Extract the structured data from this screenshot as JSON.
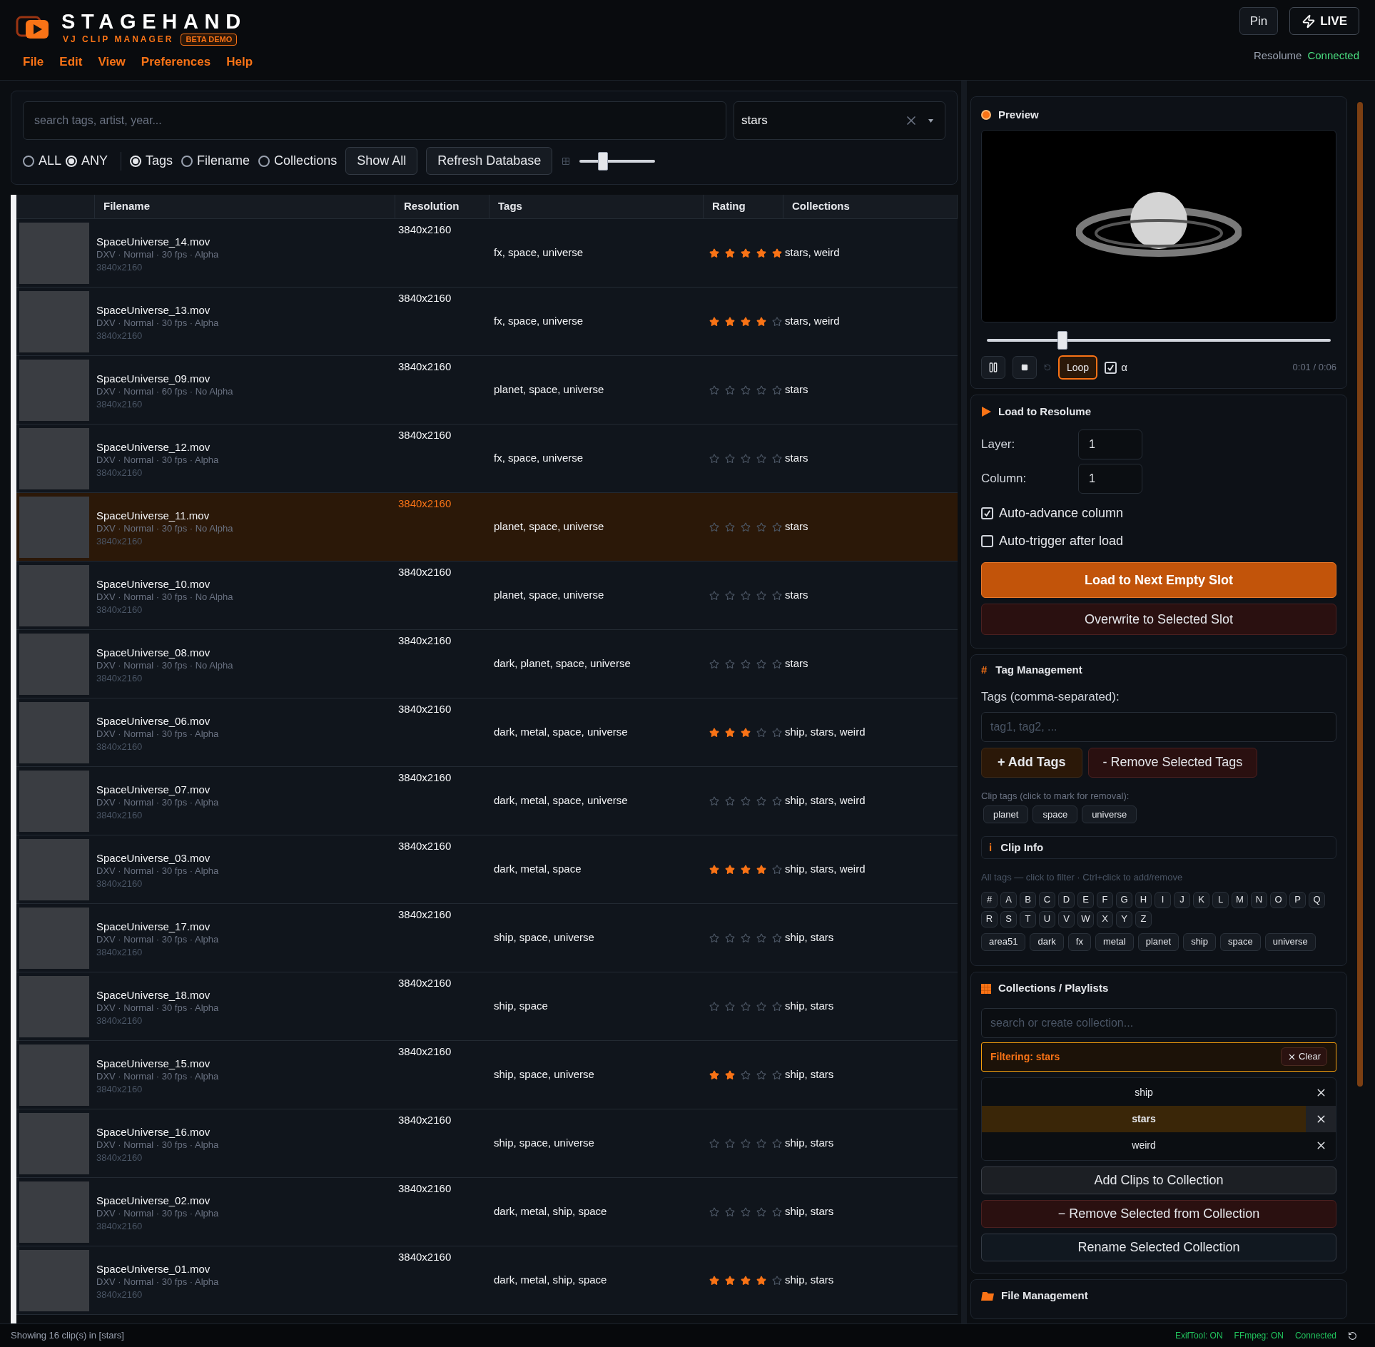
{
  "app": {
    "title": "STAGEHAND",
    "subtitle": "VJ CLIP MANAGER",
    "badge": "BETA DEMO"
  },
  "menu": [
    "File",
    "Edit",
    "View",
    "Preferences",
    "Help"
  ],
  "header_buttons": {
    "pin": "Pin",
    "live": "LIVE"
  },
  "connection": {
    "label": "Resolume",
    "status": "Connected"
  },
  "search": {
    "placeholder": "search tags, artist, year...",
    "filter_value": "stars"
  },
  "match_modes": [
    {
      "label": "ALL",
      "selected": false
    },
    {
      "label": "ANY",
      "selected": true
    }
  ],
  "search_fields": [
    {
      "label": "Tags",
      "selected": true
    },
    {
      "label": "Filename",
      "selected": false
    },
    {
      "label": "Collections",
      "selected": false
    }
  ],
  "toolbar_buttons": [
    "Show All",
    "Refresh Database"
  ],
  "thumb_size": {
    "level": 0.31
  },
  "table": {
    "columns": [
      "Filename",
      "Resolution",
      "Tags",
      "Rating",
      "Collections"
    ],
    "rows": [
      {
        "filename": "SpaceUniverse_14.mov",
        "meta": "DXV · Normal · 30 fps · Alpha",
        "size": "3840x2160",
        "resolution": "3840x2160",
        "tags": "fx, space, universe",
        "stars": 5,
        "collections": "stars, weird",
        "selected": false
      },
      {
        "filename": "SpaceUniverse_13.mov",
        "meta": "DXV · Normal · 30 fps · Alpha",
        "size": "3840x2160",
        "resolution": "3840x2160",
        "tags": "fx, space, universe",
        "stars": 4,
        "collections": "stars, weird",
        "selected": false
      },
      {
        "filename": "SpaceUniverse_09.mov",
        "meta": "DXV · Normal · 60 fps · No Alpha",
        "size": "3840x2160",
        "resolution": "3840x2160",
        "tags": "planet, space, universe",
        "stars": 0,
        "collections": "stars",
        "selected": false
      },
      {
        "filename": "SpaceUniverse_12.mov",
        "meta": "DXV · Normal · 30 fps · Alpha",
        "size": "3840x2160",
        "resolution": "3840x2160",
        "tags": "fx, space, universe",
        "stars": 0,
        "collections": "stars",
        "selected": false
      },
      {
        "filename": "SpaceUniverse_11.mov",
        "meta": "DXV · Normal · 30 fps · No Alpha",
        "size": "3840x2160",
        "resolution": "3840x2160",
        "tags": "planet, space, universe",
        "stars": 0,
        "collections": "stars",
        "selected": true
      },
      {
        "filename": "SpaceUniverse_10.mov",
        "meta": "DXV · Normal · 30 fps · No Alpha",
        "size": "3840x2160",
        "resolution": "3840x2160",
        "tags": "planet, space, universe",
        "stars": 0,
        "collections": "stars",
        "selected": false
      },
      {
        "filename": "SpaceUniverse_08.mov",
        "meta": "DXV · Normal · 30 fps · No Alpha",
        "size": "3840x2160",
        "resolution": "3840x2160",
        "tags": "dark, planet, space, universe",
        "stars": 0,
        "collections": "stars",
        "selected": false
      },
      {
        "filename": "SpaceUniverse_06.mov",
        "meta": "DXV · Normal · 30 fps · Alpha",
        "size": "3840x2160",
        "resolution": "3840x2160",
        "tags": "dark, metal, space, universe",
        "stars": 3,
        "collections": "ship, stars, weird",
        "selected": false
      },
      {
        "filename": "SpaceUniverse_07.mov",
        "meta": "DXV · Normal · 30 fps · Alpha",
        "size": "3840x2160",
        "resolution": "3840x2160",
        "tags": "dark, metal, space, universe",
        "stars": 0,
        "collections": "ship, stars, weird",
        "selected": false
      },
      {
        "filename": "SpaceUniverse_03.mov",
        "meta": "DXV · Normal · 30 fps · Alpha",
        "size": "3840x2160",
        "resolution": "3840x2160",
        "tags": "dark, metal, space",
        "stars": 4,
        "collections": "ship, stars, weird",
        "selected": false
      },
      {
        "filename": "SpaceUniverse_17.mov",
        "meta": "DXV · Normal · 30 fps · Alpha",
        "size": "3840x2160",
        "resolution": "3840x2160",
        "tags": "ship, space, universe",
        "stars": 0,
        "collections": "ship, stars",
        "selected": false
      },
      {
        "filename": "SpaceUniverse_18.mov",
        "meta": "DXV · Normal · 30 fps · Alpha",
        "size": "3840x2160",
        "resolution": "3840x2160",
        "tags": "ship, space",
        "stars": 0,
        "collections": "ship, stars",
        "selected": false
      },
      {
        "filename": "SpaceUniverse_15.mov",
        "meta": "DXV · Normal · 30 fps · Alpha",
        "size": "3840x2160",
        "resolution": "3840x2160",
        "tags": "ship, space, universe",
        "stars": 2,
        "collections": "ship, stars",
        "selected": false
      },
      {
        "filename": "SpaceUniverse_16.mov",
        "meta": "DXV · Normal · 30 fps · Alpha",
        "size": "3840x2160",
        "resolution": "3840x2160",
        "tags": "ship, space, universe",
        "stars": 0,
        "collections": "ship, stars",
        "selected": false
      },
      {
        "filename": "SpaceUniverse_02.mov",
        "meta": "DXV · Normal · 30 fps · Alpha",
        "size": "3840x2160",
        "resolution": "3840x2160",
        "tags": "dark, metal, ship, space",
        "stars": 0,
        "collections": "ship, stars",
        "selected": false
      },
      {
        "filename": "SpaceUniverse_01.mov",
        "meta": "DXV · Normal · 30 fps · Alpha",
        "size": "3840x2160",
        "resolution": "3840x2160",
        "tags": "dark, metal, ship, space",
        "stars": 4,
        "collections": "ship, stars",
        "selected": false
      }
    ]
  },
  "preview": {
    "title": "Preview",
    "scrub": {
      "level": 0.22
    },
    "loop": {
      "label": "Loop",
      "on": true
    },
    "alpha": {
      "label": "α",
      "checked": true
    },
    "time": "0:01 / 0:06"
  },
  "load": {
    "title": "Load to Resolume",
    "fields": [
      {
        "label": "Layer:",
        "value": "1"
      },
      {
        "label": "Column:",
        "value": "1"
      }
    ],
    "options": [
      {
        "label": "Auto-advance column",
        "checked": true
      },
      {
        "label": "Auto-trigger after load",
        "checked": false
      }
    ],
    "primary": "Load to Next Empty Slot",
    "secondary": "Overwrite to Selected Slot"
  },
  "tag_management": {
    "icon": "#",
    "title": "Tag Management",
    "label": "Tags (comma-separated):",
    "placeholder": "tag1, tag2, ...",
    "add": "+ Add Tags",
    "remove": "- Remove Selected Tags",
    "clip_tags_label": "Clip tags (click to mark for removal):",
    "clip_tags": [
      "planet",
      "space",
      "universe"
    ],
    "info_icon": "i",
    "info_title": "Clip Info",
    "all_tags_hint": "All tags — click to filter · Ctrl+click to add/remove",
    "letters": [
      "#",
      "A",
      "B",
      "C",
      "D",
      "E",
      "F",
      "G",
      "H",
      "I",
      "J",
      "K",
      "L",
      "M",
      "N",
      "O",
      "P",
      "Q",
      "R",
      "S",
      "T",
      "U",
      "V",
      "W",
      "X",
      "Y",
      "Z"
    ],
    "all_tags": [
      "area51",
      "dark",
      "fx",
      "metal",
      "planet",
      "ship",
      "space",
      "universe"
    ]
  },
  "collections": {
    "title": "Collections / Playlists",
    "placeholder": "search or create collection...",
    "filter": "Filtering: stars",
    "clear": "Clear",
    "items": [
      {
        "name": "ship",
        "selected": false
      },
      {
        "name": "stars",
        "selected": true
      },
      {
        "name": "weird",
        "selected": false
      }
    ],
    "buttons": [
      {
        "label": "Add Clips to Collection",
        "kind": "neutral"
      },
      {
        "label": "− Remove Selected from Collection",
        "kind": "danger"
      },
      {
        "label": "Rename Selected Collection",
        "kind": "secondary"
      }
    ]
  },
  "file_management": {
    "title": "File Management"
  },
  "status_bar": {
    "summary": "Showing 16 clip(s) in [stars]",
    "indicators": [
      "ExifTool: ON",
      "FFmpeg: ON",
      "Connected"
    ]
  }
}
